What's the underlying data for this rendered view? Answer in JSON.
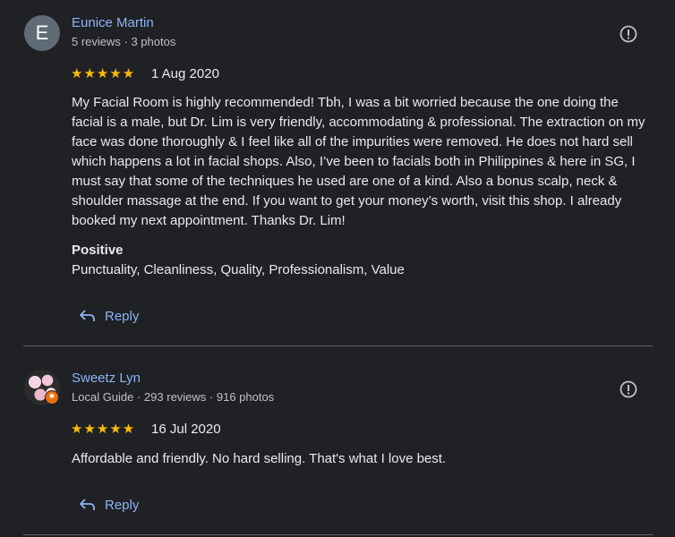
{
  "reviews": [
    {
      "avatar_letter": "E",
      "name": "Eunice Martin",
      "meta": "5 reviews · 3 photos",
      "stars": "★★★★★",
      "rating": 5,
      "date": "1 Aug 2020",
      "text": "My Facial Room is highly recommended! Tbh, I was a bit worried because the one doing the facial is a male, but Dr. Lim is very friendly, accommodating & professional. The extraction on my face was done thoroughly & I feel like all of the impurities were removed. He does not hard sell which happens a lot in facial shops. Also, I’ve been to facials both in Philippines & here in SG, I must say that some of the techniques he used are one of a kind. Also a bonus scalp, neck & shoulder massage at the end. If you want to get your money’s worth, visit this shop. I already booked my next appointment. Thanks Dr. Lim!",
      "positive_label": "Positive",
      "positive_values": "Punctuality, Cleanliness, Quality, Professionalism, Value",
      "reply_label": "Reply"
    },
    {
      "name": "Sweetz Lyn",
      "meta": "Local Guide · 293 reviews · 916 photos",
      "stars": "★★★★★",
      "rating": 5,
      "date": "16 Jul 2020",
      "text": "Affordable and friendly. No hard selling. That's what I love best.",
      "reply_label": "Reply"
    }
  ],
  "colors": {
    "background": "#202124",
    "link": "#8ab4f8",
    "star": "#fbbc04",
    "guide_badge": "#e8710a"
  },
  "icons": {
    "flag": "report-flag-icon",
    "reply": "reply-arrow-icon",
    "guide": "local-guide-badge-icon"
  }
}
